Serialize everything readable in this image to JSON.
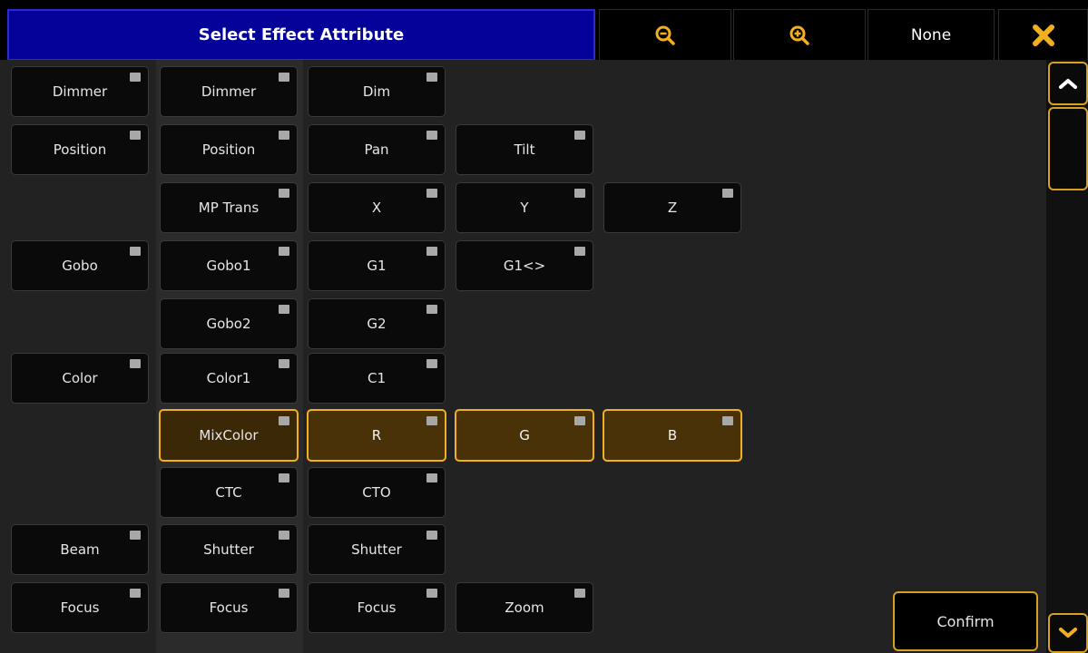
{
  "header": {
    "title": "Select Effect Attribute",
    "zoom_out_icon": "zoom-out-icon",
    "zoom_in_icon": "zoom-in-icon",
    "none_label": "None",
    "close_icon": "close-icon"
  },
  "colors": {
    "title_bg": "#05029a",
    "accent": "#f0b020",
    "selected_bg": "#4a3208",
    "grid_bg": "#222222",
    "button_bg": "#0a0a0a",
    "indicator": "#a8a8a8"
  },
  "grid": {
    "row1": [
      "Dimmer",
      "Dimmer",
      "Dim"
    ],
    "row2": [
      "Position",
      "Position",
      "Pan",
      "Tilt"
    ],
    "row3": [
      "MP Trans",
      "X",
      "Y",
      "Z"
    ],
    "row4": [
      "Gobo",
      "Gobo1",
      "G1",
      "G1<>"
    ],
    "row5": [
      "Gobo2",
      "G2"
    ],
    "row6": [
      "Color",
      "Color1",
      "C1"
    ],
    "row7": [
      "MixColor",
      "R",
      "G",
      "B"
    ],
    "row8": [
      "CTC",
      "CTO"
    ],
    "row9": [
      "Beam",
      "Shutter",
      "Shutter"
    ],
    "row10": [
      "Focus",
      "Focus",
      "Focus",
      "Zoom"
    ]
  },
  "footer": {
    "confirm_label": "Confirm"
  },
  "scrollbar": {
    "up_icon": "chevron-up-icon",
    "down_icon": "chevron-down-icon"
  }
}
